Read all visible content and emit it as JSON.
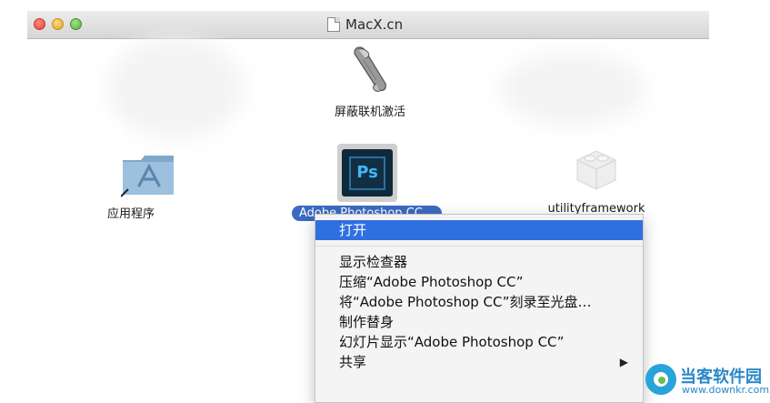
{
  "window": {
    "title": "MacX.cn"
  },
  "icons": [
    {
      "label": "屏蔽联机激活",
      "icon": "script-icon"
    },
    {
      "label": "应用程序",
      "icon": "applications-folder-icon"
    },
    {
      "label": "Adobe Photoshop CC",
      "icon": "photoshop-app-icon",
      "selected": true
    },
    {
      "label": "utilityframework",
      "icon": "lego-brick-icon"
    }
  ],
  "context_menu": {
    "items": [
      {
        "label": "打开",
        "selected": true
      },
      {
        "label": "显示检查器"
      },
      {
        "label": "压缩“Adobe Photoshop CC”"
      },
      {
        "label": "将“Adobe Photoshop CC”刻录至光盘…"
      },
      {
        "label": "制作替身"
      },
      {
        "label": "幻灯片显示“Adobe Photoshop CC”"
      },
      {
        "label": "共享",
        "submenu_arrow": "▶"
      }
    ]
  },
  "watermark": {
    "title": "当客软件园",
    "url": "www.downkr.com"
  },
  "colors": {
    "selection": "#2f6fe0",
    "label_selection": "#3c6ac2",
    "watermark": "#2a88c9"
  }
}
